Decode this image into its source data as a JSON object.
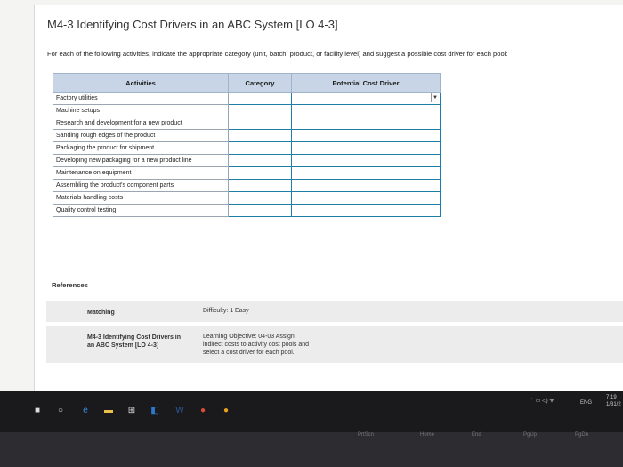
{
  "title": "M4-3 Identifying Cost Drivers in an ABC System [LO 4-3]",
  "instructions": "For each of the following activities, indicate the appropriate category (unit, batch, product, or facility level) and suggest a possible cost driver for each pool:",
  "table": {
    "headers": [
      "Activities",
      "Category",
      "Potential Cost Driver"
    ],
    "rows": [
      "Factory utilities",
      "Machine setups",
      "Research and development for a new product",
      "Sanding rough edges of the product",
      "Packaging the product for shipment",
      "Developing new packaging for a new product line",
      "Maintenance on equipment",
      "Assembling the product's component parts",
      "Materials handling costs",
      "Quality control testing"
    ]
  },
  "references": {
    "label": "References",
    "type": "Matching",
    "difficulty": "Difficulty: 1 Easy",
    "item_title": "M4-3 Identifying Cost Drivers in an ABC System [LO 4-3]",
    "objective": "Learning Objective: 04-03 Assign indirect costs to activity cost pools and select a cost driver for each pool."
  },
  "taskbar": {
    "time": "7:19",
    "date": "1/31/2",
    "lang": "ENG",
    "icons": [
      "windows-icon",
      "search-icon",
      "edge-icon",
      "file-explorer-icon",
      "store-icon",
      "outlook-icon",
      "word-icon",
      "chrome-icon",
      "media-icon"
    ]
  },
  "keyboard": [
    "PrtScn",
    "Home",
    "End",
    "PgUp",
    "PgDn"
  ]
}
